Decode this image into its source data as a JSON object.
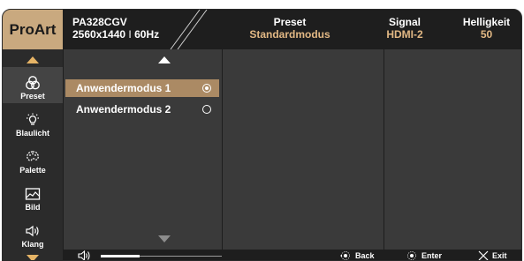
{
  "header": {
    "brand": "ProArt",
    "model": "PA328CGV",
    "resolution": "2560x1440",
    "refresh": "60Hz",
    "preset_title": "Preset",
    "preset_value": "Standardmodus",
    "signal_title": "Signal",
    "signal_value": "HDMI-2",
    "brightness_title": "Helligkeit",
    "brightness_value": "50"
  },
  "sidebar": {
    "items": [
      {
        "label": "Preset",
        "icon": "preset-icon",
        "active": true
      },
      {
        "label": "Blaulicht",
        "icon": "blue-light-icon",
        "active": false
      },
      {
        "label": "Palette",
        "icon": "palette-icon",
        "active": false
      },
      {
        "label": "Bild",
        "icon": "image-icon",
        "active": false
      },
      {
        "label": "Klang",
        "icon": "speaker-icon",
        "active": false
      }
    ]
  },
  "options": [
    {
      "label": "Anwendermodus 1",
      "selected": true
    },
    {
      "label": "Anwendermodus 2",
      "selected": false
    }
  ],
  "footer": {
    "volume_fraction": 0.32,
    "back_label": "Back",
    "enter_label": "Enter",
    "exit_label": "Exit"
  },
  "colors": {
    "accent": "#e2b884",
    "brand_bg": "#c9a97f",
    "selected_row": "#ab8a64",
    "panel": "#3a3a3a",
    "header_bg": "#1e1e1e"
  }
}
